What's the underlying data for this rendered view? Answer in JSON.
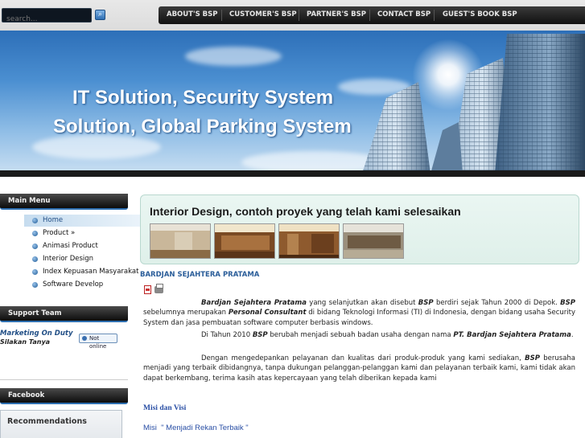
{
  "search": {
    "placeholder": "search..."
  },
  "nav": {
    "items": [
      "ABOUT'S BSP",
      "CUSTOMER'S BSP",
      "PARTNER'S BSP",
      "CONTACT BSP",
      "GUEST'S BOOK BSP"
    ]
  },
  "banner": {
    "line1": "IT Solution, Security System",
    "line2": "Solution, Global Parking System"
  },
  "sidebar": {
    "main_menu_title": "Main Menu",
    "menu_items": [
      "Home",
      "Product »",
      "Animasi Product",
      "Interior Design",
      "Index Kepuasan Masyarakat",
      "Software Develop"
    ],
    "support_title": "Support Team",
    "marketing_label": "Marketing On Duty",
    "marketing_sub": "Silakan Tanya",
    "online_status": "Not online",
    "facebook_title": "Facebook",
    "recommendations_title": "Recommendations"
  },
  "article": {
    "title": "Interior Design, contoh proyek yang telah kami selesaikan",
    "company_heading": "BARDJAN SEJAHTERA PRATAMA",
    "p1_company": "Bardjan Sejahtera Pratama",
    "p1_a": " yang selanjutkan akan disebut ",
    "p1_bsp": "BSP",
    "p1_b": " berdiri sejak  Tahun 2000 di Depok. ",
    "p1_bsp2": "BSP",
    "p1_c": " sebelumnya merupakan ",
    "p1_consultant": "Personal Consultant",
    "p1_d": " di bidang Teknologi Informasi (TI) di Indonesia, dengan bidang usaha Security System dan jasa pembuatan software computer berbasis windows.",
    "p2_a": "Di Tahun 2010 ",
    "p2_bsp": "BSP",
    "p2_b": " berubah menjadi sebuah badan usaha dengan nama ",
    "p2_pt": "PT. Bardjan Sejahtera Pratama",
    "p2_c": ".",
    "p3_a": "Dengan mengedepankan pelayanan dan kualitas dari produk-produk yang kami sediakan, ",
    "p3_bsp": "BSP",
    "p3_b": " berusaha menjadi yang terbaik dibidangnya, tanpa dukungan pelanggan-pelanggan kami dan pelayanan terbaik kami, kami tidak akan dapat berkembang, terima kasih atas kepercayaan yang telah diberikan kepada kami",
    "misi_heading": "Misi dan Visi",
    "misi_text": "Misi  \" Menjadi Rekan Terbaik \""
  }
}
